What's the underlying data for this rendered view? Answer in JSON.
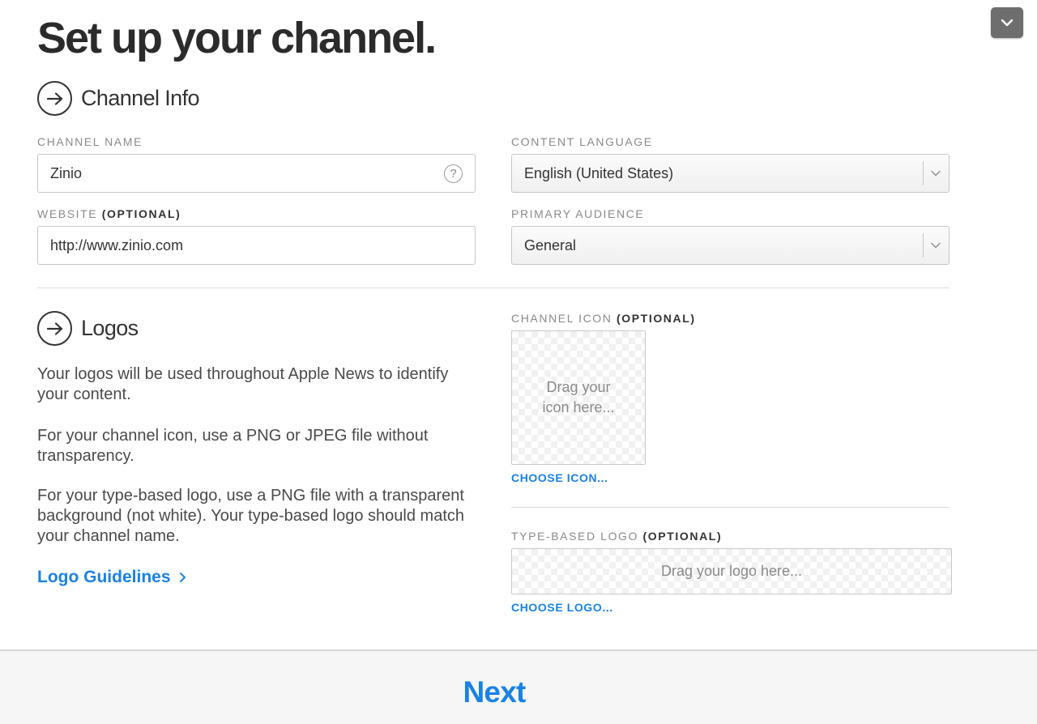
{
  "page": {
    "title": "Set up your channel."
  },
  "channel_info": {
    "heading": "Channel Info",
    "channel_name": {
      "label": "CHANNEL NAME",
      "value": "Zinio",
      "help": "?"
    },
    "website": {
      "label": "WEBSITE",
      "optional": "(OPTIONAL)",
      "value": "http://www.zinio.com"
    },
    "content_language": {
      "label": "CONTENT LANGUAGE",
      "value": "English (United States)"
    },
    "primary_audience": {
      "label": "PRIMARY AUDIENCE",
      "value": "General"
    }
  },
  "logos": {
    "heading": "Logos",
    "paragraph_1": "Your logos will be used throughout Apple News to identify your content.",
    "paragraph_2": "For your channel icon, use a PNG or JPEG file without transparency.",
    "paragraph_3": "For your type-based logo, use a PNG file with a transparent background (not white). Your type-based logo should match your channel name.",
    "guidelines_link": "Logo Guidelines",
    "channel_icon": {
      "label": "CHANNEL ICON",
      "optional": "(OPTIONAL)",
      "drop_line_1": "Drag your",
      "drop_line_2": "icon here...",
      "choose": "CHOOSE ICON..."
    },
    "type_logo": {
      "label": "TYPE-BASED LOGO",
      "optional": "(OPTIONAL)",
      "drop_text": "Drag your logo here...",
      "choose": "CHOOSE LOGO..."
    }
  },
  "footer": {
    "next_label": "Next"
  },
  "icons": {
    "collapse": "chevron-down-icon",
    "section": "arrow-right-circle-icon",
    "help": "question-circle-icon",
    "link": "chevron-right-icon"
  },
  "colors": {
    "accent": "#1a82e2",
    "collapse_button": "#6e6e6e",
    "footer_bg": "#f6f6f6"
  }
}
